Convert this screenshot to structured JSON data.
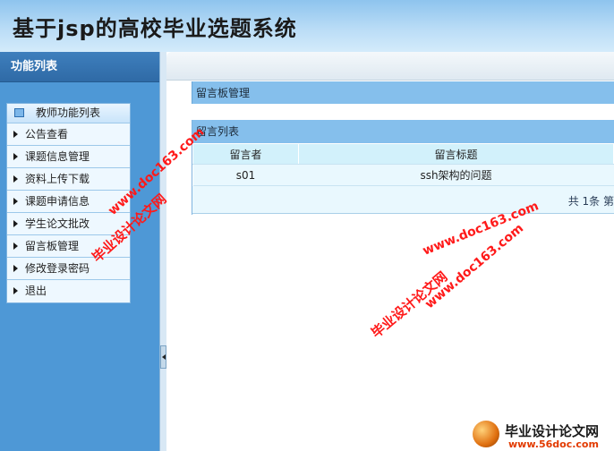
{
  "app": {
    "title": "基于jsp的高校毕业选题系统"
  },
  "sidebar": {
    "title": "功能列表",
    "menu_title": "教师功能列表",
    "items": [
      {
        "label": "公告查看"
      },
      {
        "label": "课题信息管理"
      },
      {
        "label": "资料上传下载"
      },
      {
        "label": "课题申请信息"
      },
      {
        "label": "学生论文批改"
      },
      {
        "label": "留言板管理"
      },
      {
        "label": "修改登录密码"
      },
      {
        "label": "退出"
      }
    ]
  },
  "main": {
    "breadcrumb": "留言板管理",
    "list_title": "留言列表",
    "table": {
      "headers": [
        "留言者",
        "留言标题"
      ],
      "rows": [
        [
          "s01",
          "ssh架构的问题"
        ]
      ]
    },
    "pager_text": "共 1条 第"
  },
  "watermarks": {
    "url": "www.doc163.com",
    "site": "毕业设计论文网"
  },
  "footer_logo": {
    "name": "毕业设计论文网",
    "url": "www.56doc.com"
  },
  "colors": {
    "header_gradient_top": "#8ec4ee",
    "sidebar_bg": "#4e98d6",
    "panel_header": "#85bfec",
    "table_header": "#d2f1fb",
    "watermark": "#ff1a1a"
  }
}
